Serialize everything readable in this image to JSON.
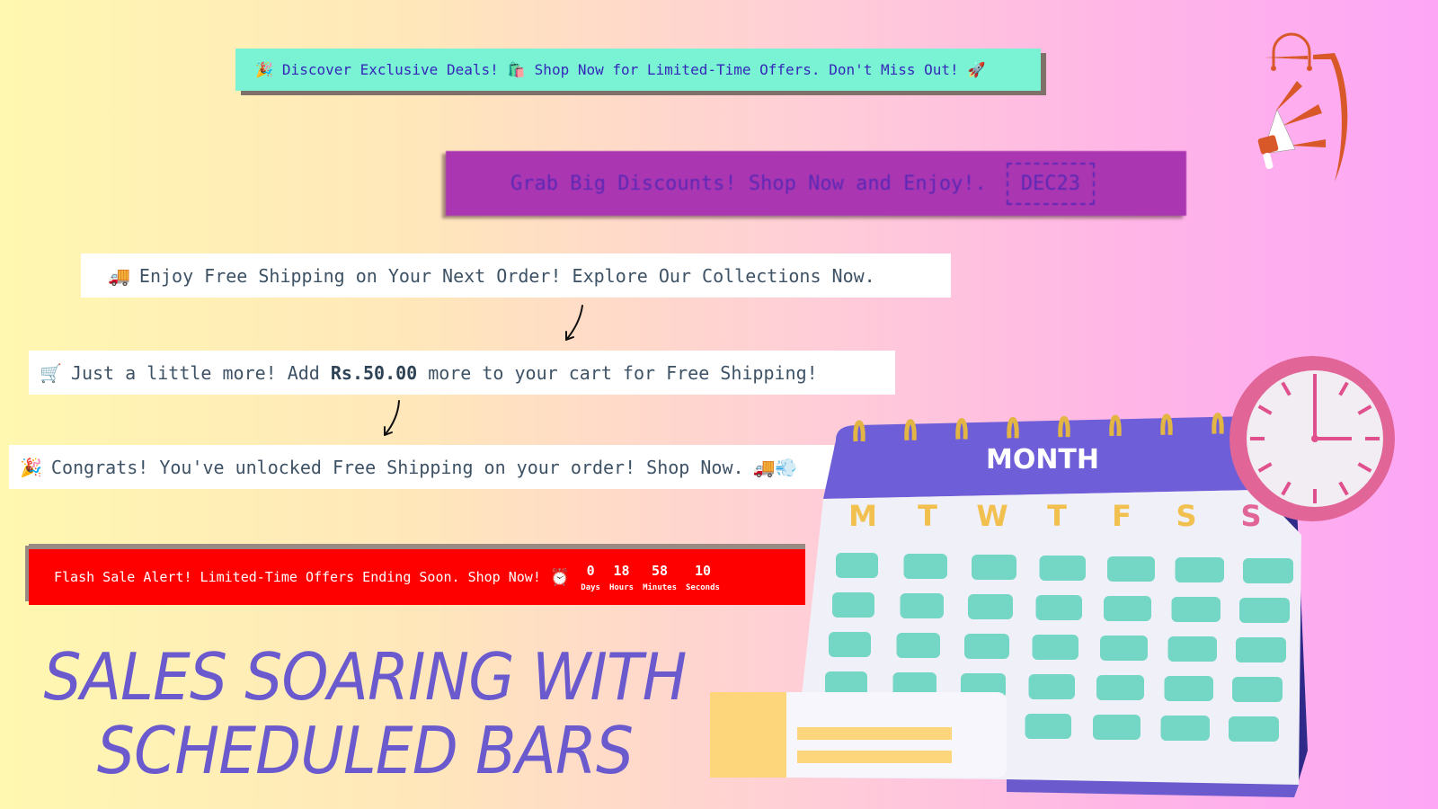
{
  "banners": {
    "teal": {
      "icon_start": "🎉",
      "text_1": "Discover Exclusive Deals!",
      "icon_mid": "🛍️",
      "text_2": "Shop Now for Limited-Time Offers. Don't Miss Out!",
      "icon_end": "🚀",
      "bg_color": "#7af2d4"
    },
    "purple": {
      "text": "Grab Big Discounts! Shop Now and Enjoy!.",
      "coupon_code": "DEC23",
      "bg_color": "#aa36b2"
    },
    "free_shipping": {
      "icon": "🚚",
      "text": "Enjoy Free Shipping on Your Next Order! Explore Our Collections Now."
    },
    "progress": {
      "icon": "🛒",
      "text_before": "Just a little more! Add",
      "amount": "Rs.50.00",
      "text_after": "more to your cart for Free Shipping!"
    },
    "unlocked": {
      "icon_start": "🎉",
      "text": "Congrats! You've unlocked Free Shipping on your order! Shop Now.",
      "icon_end": "🚚💨"
    },
    "flash_sale": {
      "text": "Flash Sale Alert! Limited-Time Offers Ending Soon. Shop Now!",
      "icon": "⏰",
      "bg_color": "#ff0000",
      "countdown": [
        {
          "value": "0",
          "label": "Days"
        },
        {
          "value": "18",
          "label": "Hours"
        },
        {
          "value": "58",
          "label": "Minutes"
        },
        {
          "value": "10",
          "label": "Seconds"
        }
      ]
    }
  },
  "headline": {
    "line1": "SALES SOARING WITH",
    "line2": "SCHEDULED BARS",
    "color": "#6a5acd"
  },
  "calendar": {
    "title": "MONTH",
    "weekdays": [
      "M",
      "T",
      "W",
      "T",
      "F",
      "S",
      "S"
    ]
  },
  "icons": {
    "logo": "megaphone-shopping-bag-icon",
    "clock": "wall-clock-icon"
  }
}
